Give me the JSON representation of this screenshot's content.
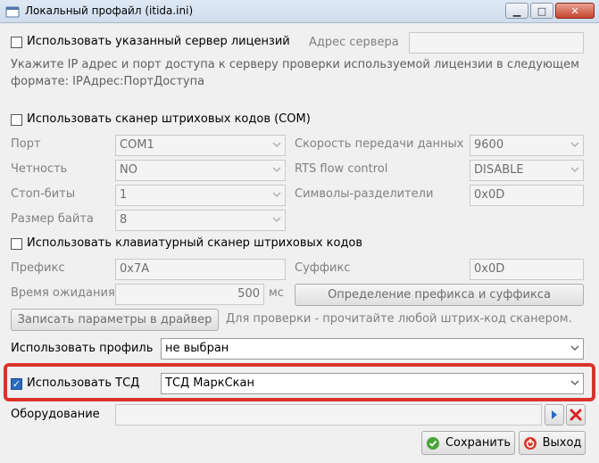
{
  "window": {
    "title": "Локальный профайл (itida.ini)"
  },
  "license": {
    "checkbox_label": "Использовать указанный сервер лицензий",
    "checked": false,
    "address_label": "Адрес сервера",
    "address_value": "",
    "hint": "Укажите IP адрес и порт доступа к серверу проверки используемой лицензии в следующем формате: IPАдрес:ПортДоступа"
  },
  "com_scanner": {
    "checkbox_label": "Использовать сканер штриховых кодов (COM)",
    "checked": false,
    "port_label": "Порт",
    "port_value": "COM1",
    "speed_label": "Скорость передачи данных",
    "speed_value": "9600",
    "parity_label": "Четность",
    "parity_value": "NO",
    "rts_label": "RTS flow control",
    "rts_value": "DISABLE",
    "stopbits_label": "Стоп-биты",
    "stopbits_value": "1",
    "separators_label": "Символы-разделители",
    "separators_value": "0x0D",
    "bytesize_label": "Размер байта",
    "bytesize_value": "8"
  },
  "kbd_scanner": {
    "checkbox_label": "Использовать клавиатурный сканер штриховых кодов",
    "checked": false,
    "prefix_label": "Префикс",
    "prefix_value": "0x7A",
    "suffix_label": "Суффикс",
    "suffix_value": "0x0D",
    "timeout_label": "Время ожидания",
    "timeout_value": "500",
    "timeout_unit": "мс",
    "detect_button": "Определение префикса и суффикса",
    "write_button": "Записать параметры в драйвер",
    "write_hint": "Для проверки - прочитайте любой штрих-код сканером."
  },
  "profile": {
    "label": "Использовать профиль",
    "value": "не выбран"
  },
  "tsd": {
    "checkbox_label": "Использовать ТСД",
    "checked": true,
    "value": "ТСД МаркСкан"
  },
  "equipment": {
    "label": "Оборудование",
    "value": ""
  },
  "actions": {
    "save": "Сохранить",
    "exit": "Выход"
  },
  "colors": {
    "highlight": "#d9342b",
    "check_on": "#2a6bbf"
  }
}
